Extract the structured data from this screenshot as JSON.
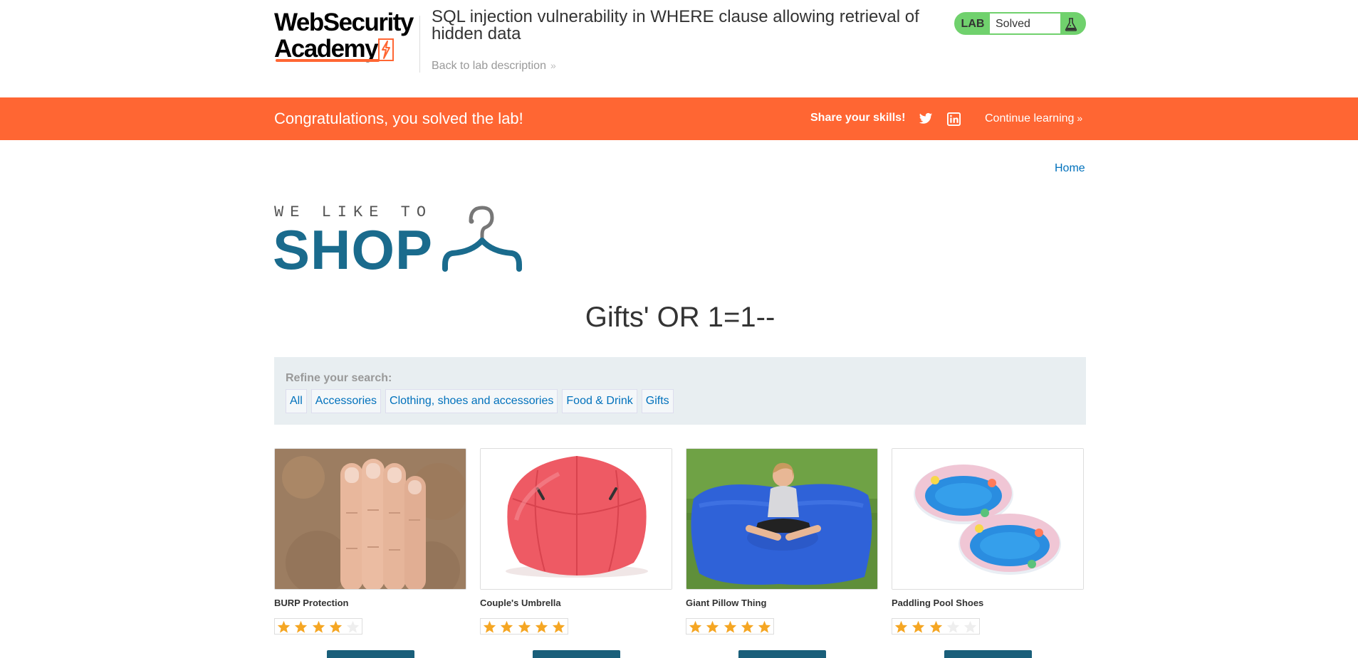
{
  "header": {
    "logo_line1": "WebSecurity",
    "logo_line2": "Academy",
    "lab_title": "SQL injection vulnerability in WHERE clause allowing retrieval of hidden data",
    "back_link": "Back to lab description",
    "lab_status": {
      "label": "LAB",
      "value": "Solved"
    }
  },
  "banner": {
    "message": "Congratulations, you solved the lab!",
    "share_label": "Share your skills!",
    "continue_label": "Continue learning"
  },
  "nav": {
    "home": "Home"
  },
  "shop_logo": {
    "tagline": "WE LIKE TO",
    "word": "SHOP"
  },
  "search_title": "Gifts' OR 1=1--",
  "refine": {
    "label": "Refine your search:",
    "filters": [
      "All",
      "Accessories",
      "Clothing, shoes and accessories",
      "Food & Drink",
      "Gifts"
    ]
  },
  "products": [
    {
      "name": "BURP Protection",
      "rating": 4,
      "image": "bearded-face-hand"
    },
    {
      "name": "Couple's Umbrella",
      "rating": 5,
      "image": "red-umbrella"
    },
    {
      "name": "Giant Pillow Thing",
      "rating": 5,
      "image": "blue-bean-bag"
    },
    {
      "name": "Paddling Pool Shoes",
      "rating": 3,
      "image": "paddling-pools"
    }
  ],
  "colors": {
    "accent": "#ff6633",
    "link": "#0071bc",
    "brand_blue": "#1a6b8d",
    "solved_green": "#70d16d",
    "star": "#f5a623"
  }
}
